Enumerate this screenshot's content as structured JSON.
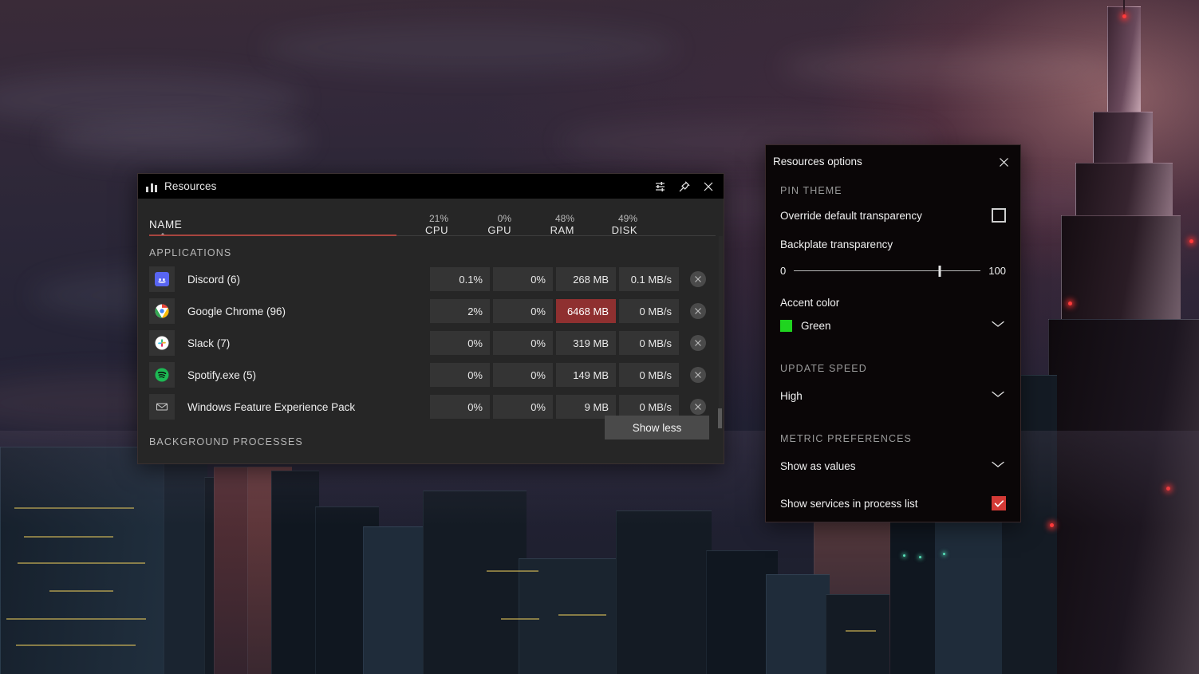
{
  "window": {
    "title": "Resources",
    "title_icon": "bar-chart-icon",
    "buttons": {
      "settings": "settings-sliders-icon",
      "pin": "pin-icon",
      "close": "close-icon"
    }
  },
  "table": {
    "sort_column": "NAME",
    "sort_direction": "ascending",
    "name_header": "NAME",
    "metrics": [
      {
        "percent": "21%",
        "name": "CPU"
      },
      {
        "percent": "0%",
        "name": "GPU"
      },
      {
        "percent": "48%",
        "name": "RAM"
      },
      {
        "percent": "49%",
        "name": "DISK"
      }
    ],
    "sections": {
      "applications": "APPLICATIONS",
      "background": "BACKGROUND PROCESSES"
    },
    "rows": [
      {
        "icon": "discord-icon",
        "name": "Discord (6)",
        "cpu": "0.1%",
        "gpu": "0%",
        "ram": "268 MB",
        "disk": "0.1 MB/s",
        "ram_alert": false,
        "close": "close-process-icon"
      },
      {
        "icon": "google-chrome-icon",
        "name": "Google Chrome (96)",
        "cpu": "2%",
        "gpu": "0%",
        "ram": "6468 MB",
        "disk": "0 MB/s",
        "ram_alert": true,
        "close": "close-process-icon"
      },
      {
        "icon": "slack-icon",
        "name": "Slack (7)",
        "cpu": "0%",
        "gpu": "0%",
        "ram": "319 MB",
        "disk": "0 MB/s",
        "ram_alert": false,
        "close": "close-process-icon"
      },
      {
        "icon": "spotify-icon",
        "name": "Spotify.exe (5)",
        "cpu": "0%",
        "gpu": "0%",
        "ram": "149 MB",
        "disk": "0 MB/s",
        "ram_alert": false,
        "close": "close-process-icon"
      },
      {
        "icon": "windows-feature-icon",
        "name": "Windows Feature Experience Pack",
        "cpu": "0%",
        "gpu": "0%",
        "ram": "9 MB",
        "disk": "0 MB/s",
        "ram_alert": false,
        "close": "close-process-icon"
      }
    ],
    "show_less_label": "Show less"
  },
  "options": {
    "title": "Resources options",
    "close_icon": "close-icon",
    "pin_theme": {
      "group_label": "PIN THEME",
      "override_label": "Override default transparency",
      "override_checked": false,
      "backplate_label": "Backplate transparency",
      "slider_min": "0",
      "slider_max": "100",
      "slider_value": 78
    },
    "accent": {
      "label": "Accent color",
      "value": "Green",
      "swatch_color": "#1fd41f",
      "chevron": "chevron-down-icon"
    },
    "update_speed": {
      "group_label": "UPDATE SPEED",
      "value": "High",
      "chevron": "chevron-down-icon"
    },
    "metric_prefs": {
      "group_label": "METRIC PREFERENCES",
      "display_mode": "Show as values",
      "display_chevron": "chevron-down-icon",
      "services_label": "Show services in process list",
      "services_checked": true
    }
  },
  "theme": {
    "accent_red": "#a8453f",
    "alert_cell": "#8f3030",
    "checkbox_checked": "#d43a36",
    "window_bg": "#262626",
    "options_bg": "#0a0607"
  }
}
